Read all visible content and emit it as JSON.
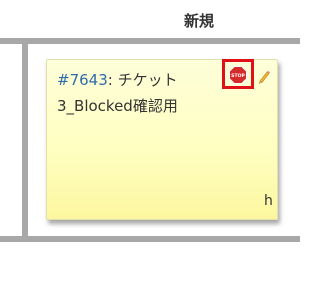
{
  "board": {
    "column_title": "新規"
  },
  "card": {
    "ticket_id": "#7643",
    "title_sep": ": ",
    "title": "チケット3_Blocked確認用",
    "assignee": "h",
    "stop_icon_text": "STOP",
    "icons": [
      "stop-icon",
      "pencil-icon"
    ],
    "colors": {
      "card_background": "#ffffc2",
      "link": "#2e6ba8",
      "highlight": "#e0101a",
      "stop_sign": "#d42a2a"
    }
  }
}
